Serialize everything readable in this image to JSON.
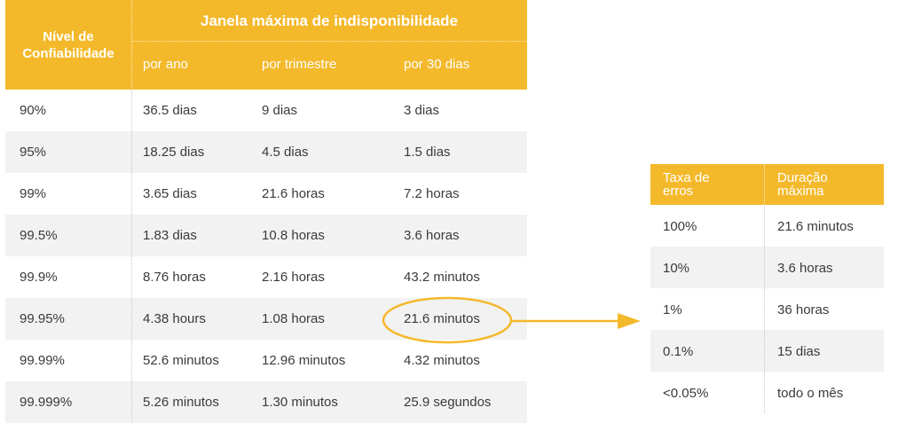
{
  "main": {
    "header": {
      "level": "Nível de\nConfiabilidade",
      "window": "Janela máxima de indisponibilidade",
      "per_year": "por ano",
      "per_quarter": "por trimestre",
      "per_30_days": "por 30 dias"
    },
    "rows": [
      [
        "90%",
        "36.5 dias",
        "9 dias",
        "3 dias"
      ],
      [
        "95%",
        "18.25 dias",
        "4.5 dias",
        "1.5 dias"
      ],
      [
        "99%",
        "3.65 dias",
        "21.6 horas",
        "7.2 horas"
      ],
      [
        "99.5%",
        "1.83 dias",
        "10.8 horas",
        "3.6 horas"
      ],
      [
        "99.9%",
        "8.76 horas",
        "2.16 horas",
        "43.2 minutos"
      ],
      [
        "99.95%",
        "4.38 hours",
        "1.08 horas",
        "21.6 minutos"
      ],
      [
        "99.99%",
        "52.6 minutos",
        "12.96 minutos",
        "4.32 minutos"
      ],
      [
        "99.999%",
        "5.26 minutos",
        "1.30 minutos",
        "25.9 segundos"
      ]
    ]
  },
  "side": {
    "header": {
      "error_rate": "Taxa de\nerros",
      "max_duration": "Duração\nmáxima"
    },
    "rows": [
      [
        "100%",
        "21.6 minutos"
      ],
      [
        "10%",
        "3.6 horas"
      ],
      [
        "1%",
        "36 horas"
      ],
      [
        "0.1%",
        "15 dias"
      ],
      [
        "<0.05%",
        "todo o mês"
      ]
    ]
  },
  "colors": {
    "accent": "#f4b92b",
    "row_alt": "#f2f2f2",
    "text": "#3a3a3a"
  }
}
